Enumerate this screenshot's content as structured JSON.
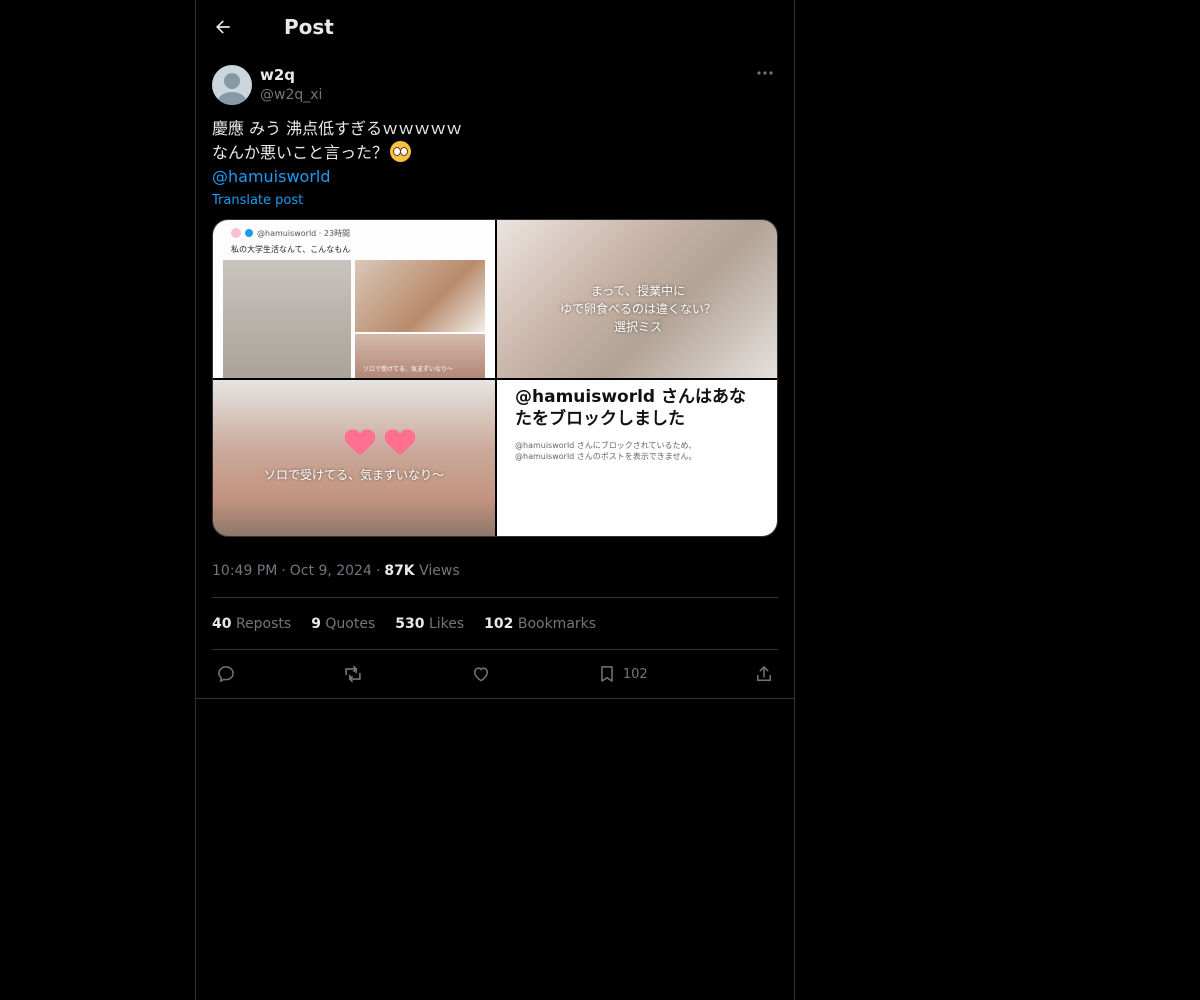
{
  "header": {
    "title": "Post"
  },
  "author": {
    "display_name": "w2q",
    "handle": "@w2q_xi"
  },
  "tweet": {
    "line1": "慶應 みう 沸点低すぎるｗｗｗｗｗ",
    "line2": "なんか悪いこと言った？",
    "mention": "@hamuisworld",
    "translate": "Translate post"
  },
  "media": {
    "tile1": {
      "handle": "@hamuisworld · 23時間",
      "caption": "私の大学生活なんて、こんなもん",
      "small": "ソロで受けてる、気まずいなり〜"
    },
    "tile2": {
      "caption": "まって、授業中に\nゆで卵食べるのは違くない？\n選択ミス"
    },
    "tile3": {
      "caption": "ソロで受けてる、気まずいなり〜"
    },
    "tile4": {
      "title": "@hamuisworld さんはあなたをブロックしました",
      "sub1": "@hamuisworld さんにブロックされているため、",
      "sub2": "@hamuisworld さんのポストを表示できません。"
    }
  },
  "meta": {
    "time": "10:49 PM",
    "date": "Oct 9, 2024",
    "views_count": "87K",
    "views_label": "Views"
  },
  "stats": {
    "reposts_count": "40",
    "reposts_label": "Reposts",
    "quotes_count": "9",
    "quotes_label": "Quotes",
    "likes_count": "530",
    "likes_label": "Likes",
    "bookmarks_count": "102",
    "bookmarks_label": "Bookmarks"
  },
  "actions": {
    "bookmark_count": "102"
  },
  "colors": {
    "accent": "#1d9bf0",
    "background": "#000000",
    "border": "#2f3336"
  }
}
